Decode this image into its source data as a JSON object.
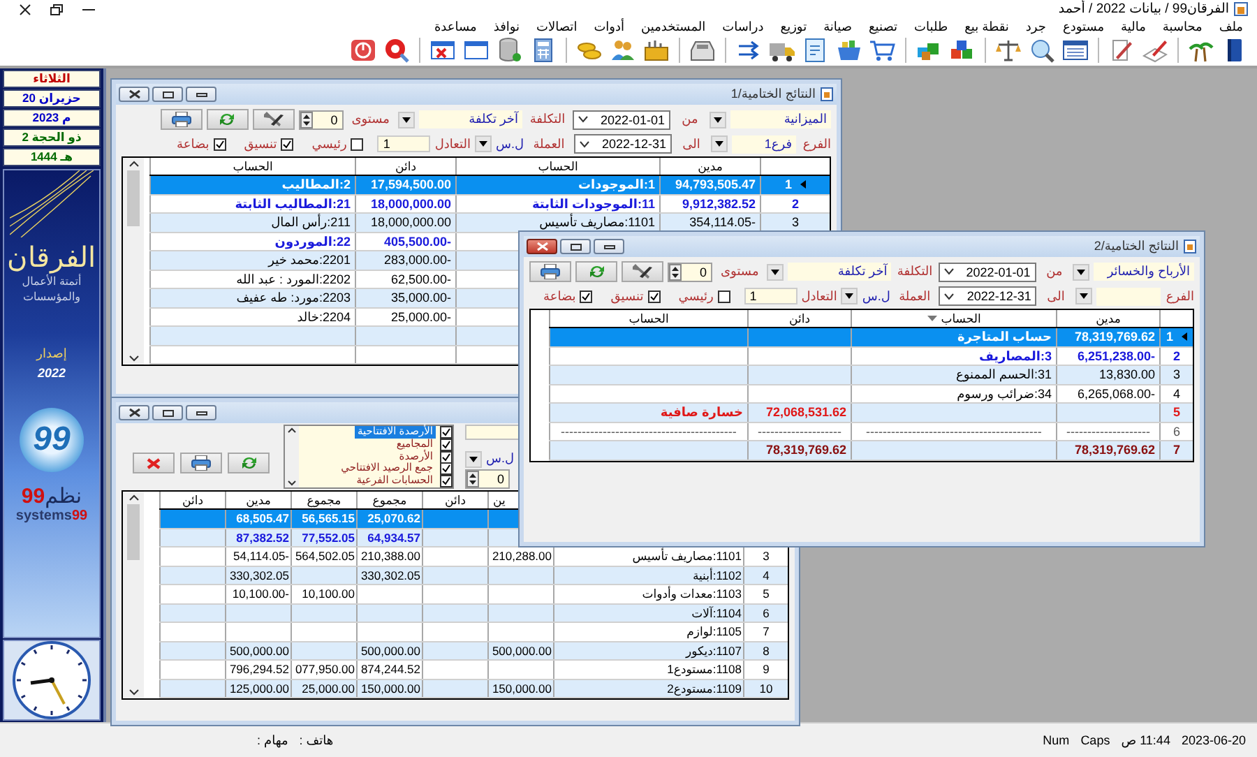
{
  "window": {
    "title": "الفرقان99 / بيانات 2022 / أحمد"
  },
  "menu": [
    "ملف",
    "محاسبة",
    "مالية",
    "مستودع",
    "جرد",
    "نقطة بيع",
    "طلبات",
    "تصنيع",
    "صيانة",
    "توزيع",
    "دراسات",
    "المستخدمين",
    "أدوات",
    "اتصالات",
    "نوافذ",
    "مساعدة"
  ],
  "sidebar": {
    "dates": [
      {
        "text": "الثلاثاء",
        "kind": "day"
      },
      {
        "text": "20 حزيران",
        "kind": "gregorian"
      },
      {
        "text": "2023 م",
        "kind": "gregorian"
      },
      {
        "text": "2 ذو الحجة",
        "kind": "hijri"
      },
      {
        "text": "1444 هـ",
        "kind": "hijri"
      }
    ],
    "logo": {
      "title": "الفرقان",
      "tagline": "أتمتة الأعمال والمؤسسات",
      "version_label": "إصدار",
      "version": "2022",
      "badge": "99",
      "brand_ar": "نظم",
      "brand_ar_num": "99",
      "brand_en": "systems",
      "brand_en_num": "99"
    }
  },
  "windows": [
    {
      "kind": "report",
      "title": "النتائج الختامية/1",
      "active": false,
      "form": {
        "report_type": "الميزانية",
        "from_label": "من",
        "from_date": "2022-01-01",
        "cost_label": "التكلفة",
        "cost": "آخر تكلفة",
        "level_label": "مستوى",
        "level_value": "0",
        "branch_label": "الفرع",
        "branch": "فرع1",
        "to_label": "الى",
        "to_date": "2022-12-31",
        "currency_label": "العملة",
        "currency": "ل.س",
        "rate_label": "التعادل",
        "rate": "1",
        "checks": [
          {
            "label": "رئيسي",
            "checked": false
          },
          {
            "label": "تنسيق",
            "checked": true
          },
          {
            "label": "بضاعة",
            "checked": true
          }
        ]
      },
      "grid": {
        "columns": [
          {
            "label": "مدين"
          },
          {
            "label": "الحساب"
          },
          {
            "label": "دائن"
          },
          {
            "label": "الحساب"
          }
        ],
        "rows": [
          {
            "num": "1",
            "selected": true,
            "kind": "group",
            "debit": "94,793,505.47",
            "account": "1:الموجودات",
            "credit": "17,594,500.00",
            "account_2": "2:المطاليب"
          },
          {
            "num": "2",
            "selected": false,
            "kind": "group",
            "debit": "9,912,382.52",
            "account": "11:الموجودات الثابتة",
            "credit": "18,000,000.00",
            "account_2": "21:المطاليب الثابتة"
          },
          {
            "num": "3",
            "selected": false,
            "kind": "item",
            "debit": "354,114.05-",
            "account": "1101:مصاريف تأسيس",
            "credit": "18,000,000.00",
            "account_2": "211:رأس المال"
          },
          {
            "selected": false,
            "kind": "group",
            "credit": "405,500.00-",
            "account_2": "22:الموردون"
          },
          {
            "selected": false,
            "kind": "item",
            "credit": "283,000.00-",
            "account_2": "2201:محمد خير"
          },
          {
            "selected": false,
            "kind": "item",
            "credit": "62,500.00-",
            "account_2": "2202:المورد : عبد الله"
          },
          {
            "selected": false,
            "kind": "item",
            "credit": "35,000.00-",
            "account_2": "2203:مورد: طه عفيف"
          },
          {
            "selected": false,
            "kind": "item",
            "credit": "25,000.00-",
            "account_2": "2204:خالد"
          },
          {
            "selected": false,
            "kind": "item"
          },
          {
            "selected": false,
            "kind": "item"
          }
        ]
      }
    },
    {
      "kind": "trial_balance",
      "active": false,
      "options": [
        {
          "label": "الأرصدة الافتتاحية",
          "checked": true,
          "selected": true
        },
        {
          "label": "المجاميع",
          "checked": true,
          "selected": false
        },
        {
          "label": "الأرصدة",
          "checked": true,
          "selected": false
        },
        {
          "label": "جمع الرصيد الافتتاحي",
          "checked": true,
          "selected": false
        },
        {
          "label": "الحسابات الفرعية",
          "checked": true,
          "selected": false
        }
      ],
      "currency": "ل.س",
      "level_value": "0",
      "grid": {
        "columns": [
          {
            "label": "ين"
          },
          {
            "label": "دائن"
          },
          {
            "label": "مجموع"
          },
          {
            "label": "مجموع"
          },
          {
            "label": "مدين"
          },
          {
            "label": "دائن"
          }
        ],
        "rows": [
          {
            "selected": true,
            "kind": "group",
            "total": "25,070.62",
            "total_2": "56,565.15",
            "debit_2": "68,505.47"
          },
          {
            "selected": false,
            "kind": "group",
            "total": "64,934.57",
            "total_2": "77,552.05",
            "debit_2": "87,382.52"
          },
          {
            "num": "3",
            "selected": false,
            "kind": "item",
            "account": "1101:مصاريف تأسيس",
            "debit": "210,288.00",
            "total": "210,388.00",
            "total_2": "564,502.05",
            "debit_2": "54,114.05-"
          },
          {
            "num": "4",
            "selected": false,
            "kind": "item",
            "account": "1102:أبنية",
            "total": "330,302.05",
            "debit_2": "330,302.05"
          },
          {
            "num": "5",
            "selected": false,
            "kind": "item",
            "account": "1103:معدات وأدوات",
            "total_2": "10,100.00",
            "debit_2": "10,100.00-"
          },
          {
            "num": "6",
            "selected": false,
            "kind": "item",
            "account": "1104:آلات"
          },
          {
            "num": "7",
            "selected": false,
            "kind": "item",
            "account": "1105:لوازم"
          },
          {
            "num": "8",
            "selected": false,
            "kind": "item",
            "account": "1107:ديكور",
            "debit": "500,000.00",
            "total": "500,000.00",
            "debit_2": "500,000.00"
          },
          {
            "num": "9",
            "selected": false,
            "kind": "item",
            "account": "1108:مستودع1",
            "total": "874,244.52",
            "total_2": "077,950.00",
            "debit_2": "796,294.52"
          },
          {
            "num": "10",
            "selected": false,
            "kind": "item",
            "account": "1109:مستودع2",
            "debit": "150,000.00",
            "total": "150,000.00",
            "total_2": "25,000.00",
            "debit_2": "125,000.00"
          }
        ]
      }
    },
    {
      "kind": "report",
      "title": "النتائج الختامية/2",
      "active": true,
      "form": {
        "report_type": "الأرباح والخسائر",
        "from_label": "من",
        "from_date": "2022-01-01",
        "cost_label": "التكلفة",
        "cost": "آخر تكلفة",
        "level_label": "مستوى",
        "level_value": "0",
        "branch_label": "الفرع",
        "to_label": "الى",
        "to_date": "2022-12-31",
        "currency_label": "العملة",
        "currency": "ل.س",
        "rate_label": "التعادل",
        "rate": "1",
        "checks": [
          {
            "label": "رئيسي",
            "checked": false
          },
          {
            "label": "تنسيق",
            "checked": true
          },
          {
            "label": "بضاعة",
            "checked": true
          }
        ]
      },
      "grid": {
        "columns": [
          {
            "label": "مدين"
          },
          {
            "label": "الحساب",
            "sortable": true
          },
          {
            "label": "دائن"
          },
          {
            "label": "الحساب"
          }
        ],
        "rows": [
          {
            "num": "1",
            "selected": true,
            "kind": "group",
            "debit": "78,319,769.62",
            "account": "حساب المتاجرة"
          },
          {
            "num": "2",
            "selected": false,
            "kind": "group",
            "debit": "6,251,238.00-",
            "account": "3:المصاريف"
          },
          {
            "num": "3",
            "selected": false,
            "kind": "item",
            "debit": "13,830.00",
            "account": "31:الحسم الممنوع"
          },
          {
            "num": "4",
            "selected": false,
            "kind": "item",
            "debit": "6,265,068.00-",
            "account": "34:ضرائب ورسوم"
          },
          {
            "num": "5",
            "selected": false,
            "kind": "loss",
            "credit": "72,068,531.62",
            "account_2": "خسارة صافية"
          },
          {
            "num": "6",
            "selected": false,
            "kind": "separator",
            "debit": "--------------------",
            "account": "------------------------------------------",
            "credit": "--------------------",
            "account_2": "------------------------------------------"
          },
          {
            "num": "7",
            "selected": false,
            "kind": "total",
            "debit": "78,319,769.62",
            "credit": "78,319,769.62"
          }
        ]
      }
    }
  ],
  "status_bar": {
    "fields": [
      "هاتف :",
      "مهام :"
    ],
    "indicators": [
      "2023-06-20",
      "11:44 ص",
      "Caps",
      "Num"
    ]
  }
}
